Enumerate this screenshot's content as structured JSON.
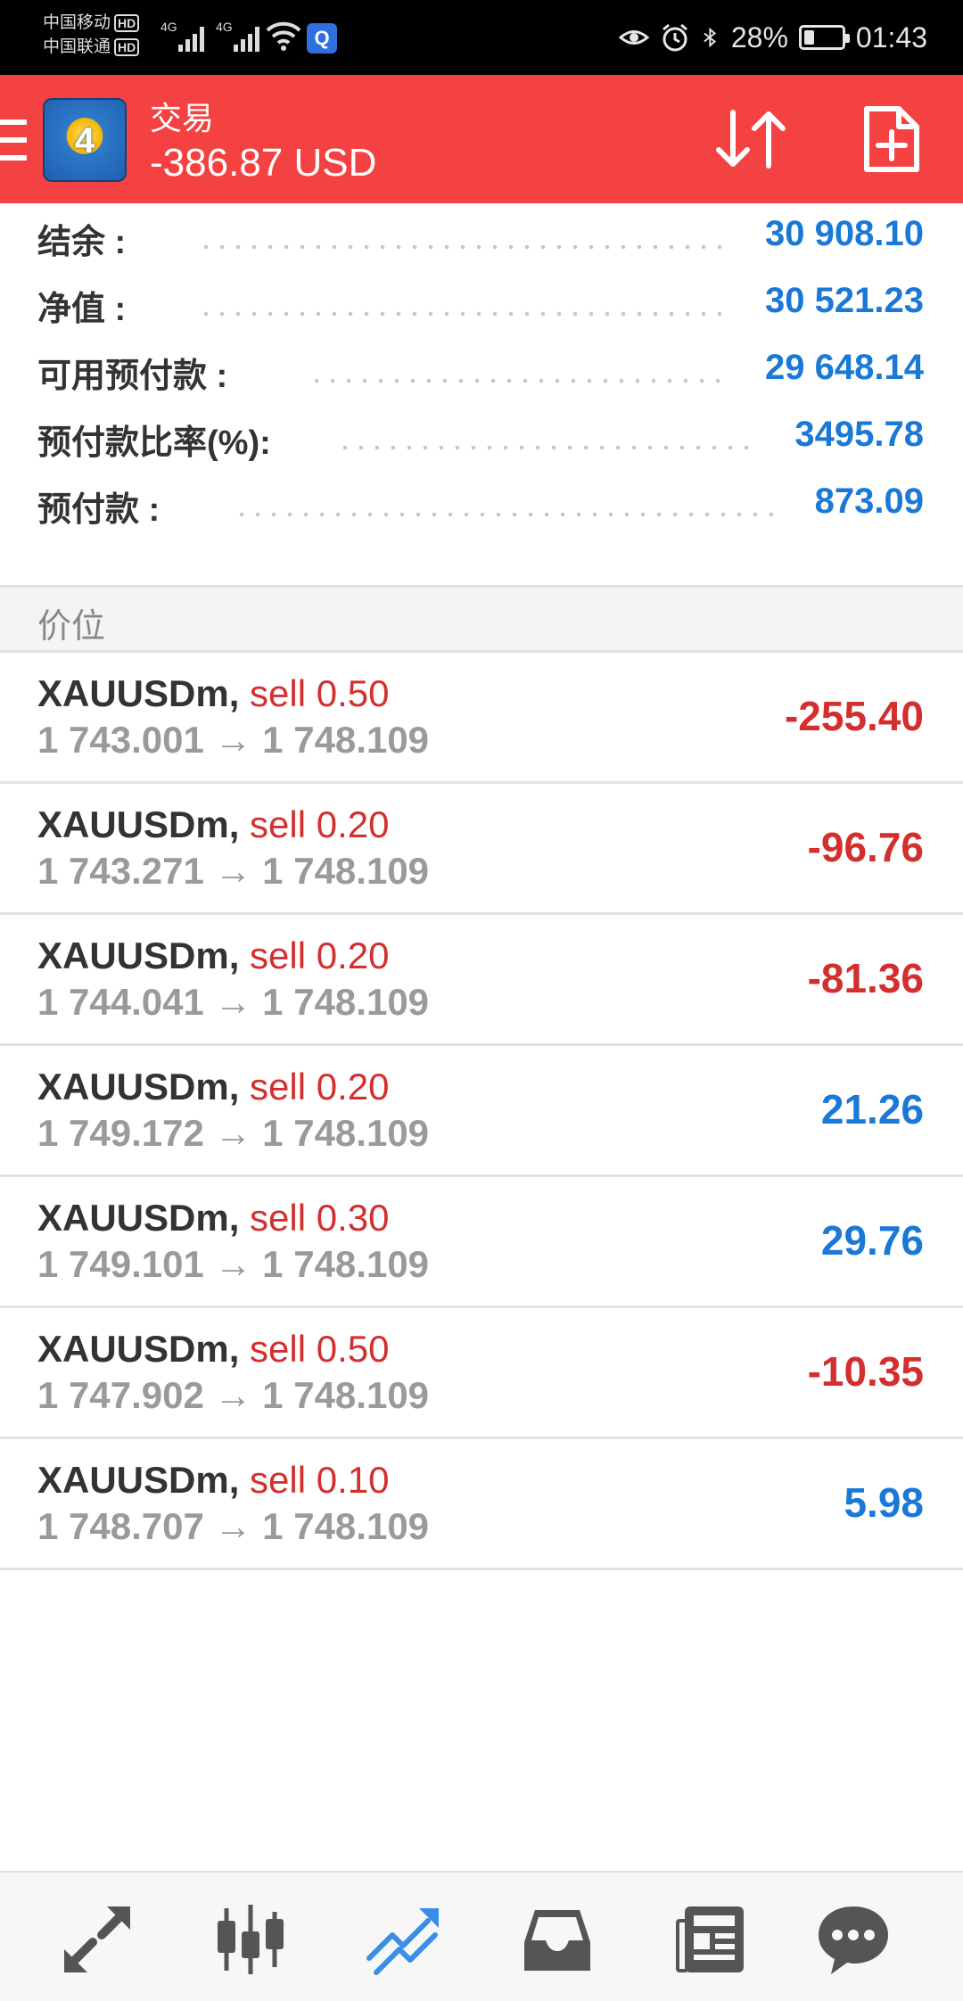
{
  "status_bar": {
    "carrier1": "中国移动",
    "carrier2": "中国联通",
    "hd": "HD",
    "network": "4G",
    "battery": "28%",
    "battery_level": 0.28,
    "time": "01:43"
  },
  "app_bar": {
    "title": "交易",
    "subtitle": "-386.87 USD",
    "logo_text": "4"
  },
  "summary": [
    {
      "label": "结余 :",
      "value": "30 908.10"
    },
    {
      "label": "净值 :",
      "value": "30 521.23"
    },
    {
      "label": "可用预付款 :",
      "value": "29 648.14"
    },
    {
      "label": "预付款比率(%):",
      "value": "3495.78"
    },
    {
      "label": "预付款 :",
      "value": "873.09"
    }
  ],
  "section_title": "价位",
  "positions": [
    {
      "symbol": "XAUUSDm,",
      "side": "sell 0.50",
      "prices": "1 743.001 → 1 748.109",
      "profit": "-255.40",
      "profit_sign": "negative"
    },
    {
      "symbol": "XAUUSDm,",
      "side": "sell 0.20",
      "prices": "1 743.271 → 1 748.109",
      "profit": "-96.76",
      "profit_sign": "negative"
    },
    {
      "symbol": "XAUUSDm,",
      "side": "sell 0.20",
      "prices": "1 744.041 → 1 748.109",
      "profit": "-81.36",
      "profit_sign": "negative"
    },
    {
      "symbol": "XAUUSDm,",
      "side": "sell 0.20",
      "prices": "1 749.172 → 1 748.109",
      "profit": "21.26",
      "profit_sign": "positive"
    },
    {
      "symbol": "XAUUSDm,",
      "side": "sell 0.30",
      "prices": "1 749.101 → 1 748.109",
      "profit": "29.76",
      "profit_sign": "positive"
    },
    {
      "symbol": "XAUUSDm,",
      "side": "sell 0.50",
      "prices": "1 747.902 → 1 748.109",
      "profit": "-10.35",
      "profit_sign": "negative"
    },
    {
      "symbol": "XAUUSDm,",
      "side": "sell 0.10",
      "prices": "1 748.707 → 1 748.109",
      "profit": "5.98",
      "profit_sign": "positive"
    }
  ],
  "bottom_nav": [
    {
      "icon": "quotes-arrows-icon",
      "active": false
    },
    {
      "icon": "chart-candles-icon",
      "active": false
    },
    {
      "icon": "trade-trend-icon",
      "active": true
    },
    {
      "icon": "inbox-icon",
      "active": false
    },
    {
      "icon": "news-icon",
      "active": false
    },
    {
      "icon": "chat-bubble-icon",
      "active": false
    }
  ],
  "colors": {
    "accent_red": "#f44141",
    "value_blue": "#1a78d7",
    "loss_red": "#d32f2f",
    "nav_active": "#3b8ee8",
    "nav_inactive": "#555555"
  }
}
